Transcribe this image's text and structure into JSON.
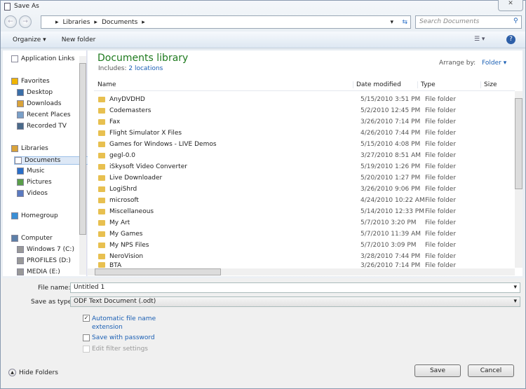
{
  "window": {
    "title": "Save As",
    "close": "✕"
  },
  "address": {
    "crumbs": [
      "Libraries",
      "Documents"
    ],
    "search_placeholder": "Search Documents"
  },
  "toolbar": {
    "organize": "Organize ▾",
    "new_folder": "New folder"
  },
  "sidebar": {
    "items": [
      {
        "label": "Application Links",
        "icon": "document-icon"
      },
      {
        "label": "Favorites",
        "icon": "star-icon"
      },
      {
        "label": "Desktop",
        "icon": "desktop-icon"
      },
      {
        "label": "Downloads",
        "icon": "downloads-icon"
      },
      {
        "label": "Recent Places",
        "icon": "recent-places-icon"
      },
      {
        "label": "Recorded TV",
        "icon": "tv-icon"
      },
      {
        "label": "Libraries",
        "icon": "library-icon"
      },
      {
        "label": "Documents",
        "icon": "documents-icon",
        "selected": true
      },
      {
        "label": "Music",
        "icon": "music-icon"
      },
      {
        "label": "Pictures",
        "icon": "pictures-icon"
      },
      {
        "label": "Videos",
        "icon": "videos-icon"
      },
      {
        "label": "Homegroup",
        "icon": "homegroup-icon"
      },
      {
        "label": "Computer",
        "icon": "computer-icon"
      },
      {
        "label": "Windows 7 (C:)",
        "icon": "drive-icon"
      },
      {
        "label": "PROFILES (D:)",
        "icon": "drive-icon"
      },
      {
        "label": "MEDIA (E:)",
        "icon": "drive-icon"
      }
    ]
  },
  "library": {
    "title": "Documents library",
    "includes": "Includes:",
    "locations": "2 locations",
    "arrange_label": "Arrange by:",
    "arrange_value": "Folder ▾"
  },
  "columns": [
    "Name",
    "Date modified",
    "Type",
    "Size"
  ],
  "files": [
    [
      "AnyDVDHD",
      "5/15/2010 3:51 PM",
      "File folder"
    ],
    [
      "Codemasters",
      "5/2/2010 12:45 PM",
      "File folder"
    ],
    [
      "Fax",
      "3/26/2010 7:14 PM",
      "File folder"
    ],
    [
      "Flight Simulator X Files",
      "4/26/2010 7:44 PM",
      "File folder"
    ],
    [
      "Games for Windows - LIVE Demos",
      "5/15/2010 4:08 PM",
      "File folder"
    ],
    [
      "gegl-0.0",
      "3/27/2010 8:51 AM",
      "File folder"
    ],
    [
      "iSkysoft Video Converter",
      "5/19/2010 1:26 PM",
      "File folder"
    ],
    [
      "Live Downloader",
      "5/20/2010 1:27 PM",
      "File folder"
    ],
    [
      "LogiShrd",
      "3/26/2010 9:06 PM",
      "File folder"
    ],
    [
      "microsoft",
      "4/24/2010 10:22 AM",
      "File folder"
    ],
    [
      "Miscellaneous",
      "5/14/2010 12:33 PM",
      "File folder"
    ],
    [
      "My Art",
      "5/7/2010 3:20 PM",
      "File folder"
    ],
    [
      "My Games",
      "5/7/2010 11:39 AM",
      "File folder"
    ],
    [
      "My NPS Files",
      "5/7/2010 3:09 PM",
      "File folder"
    ],
    [
      "NeroVision",
      "3/28/2010 7:44 PM",
      "File folder"
    ],
    [
      "BTA",
      "3/26/2010 7:14 PM",
      "File folder"
    ]
  ],
  "form": {
    "file_name_label": "File name:",
    "file_name": "Untitled 1",
    "type_label": "Save as type:",
    "type": "ODF Text Document (.odt)",
    "auto_ext": "Automatic file name extension",
    "auto_ext_checked": true,
    "password": "Save with password",
    "filter": "Edit filter settings",
    "hide_folders": "Hide Folders",
    "save": "Save",
    "cancel": "Cancel"
  }
}
